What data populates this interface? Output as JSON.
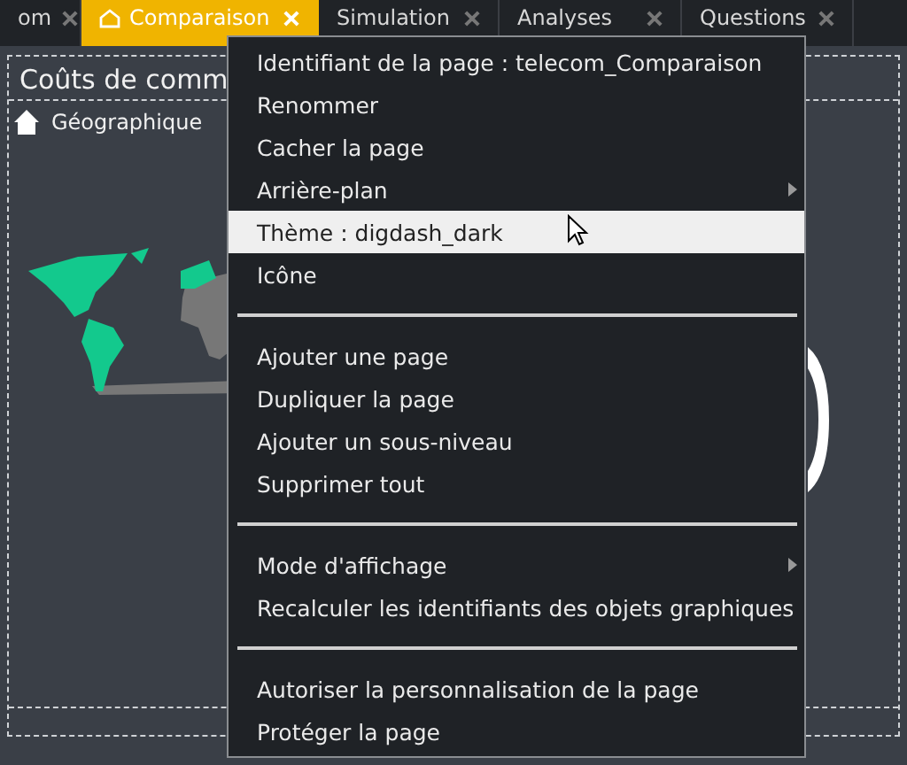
{
  "tabs": [
    {
      "label": "om",
      "selected": false,
      "icon": false
    },
    {
      "label": "Comparaison",
      "selected": true,
      "icon": true
    },
    {
      "label": "Simulation",
      "selected": false,
      "icon": false
    },
    {
      "label": "Analyses",
      "selected": false,
      "icon": false
    },
    {
      "label": "Questions",
      "selected": false,
      "icon": false
    }
  ],
  "panel": {
    "title": "Coûts de comm",
    "breadcrumb": "Géographique"
  },
  "context_menu": {
    "items": [
      {
        "kind": "item",
        "label": "Identifiant de la page : telecom_Comparaison",
        "selected": false,
        "submenu": false
      },
      {
        "kind": "item",
        "label": "Renommer",
        "selected": false,
        "submenu": false
      },
      {
        "kind": "item",
        "label": "Cacher la page",
        "selected": false,
        "submenu": false
      },
      {
        "kind": "item",
        "label": "Arrière-plan",
        "selected": false,
        "submenu": true
      },
      {
        "kind": "item",
        "label": "Thème : digdash_dark",
        "selected": true,
        "submenu": false
      },
      {
        "kind": "item",
        "label": "Icône",
        "selected": false,
        "submenu": false
      },
      {
        "kind": "separator"
      },
      {
        "kind": "item",
        "label": "Ajouter une page",
        "selected": false,
        "submenu": false
      },
      {
        "kind": "item",
        "label": "Dupliquer la page",
        "selected": false,
        "submenu": false
      },
      {
        "kind": "item",
        "label": "Ajouter un sous-niveau",
        "selected": false,
        "submenu": false
      },
      {
        "kind": "item",
        "label": "Supprimer tout",
        "selected": false,
        "submenu": false
      },
      {
        "kind": "separator"
      },
      {
        "kind": "item",
        "label": "Mode d'affichage",
        "selected": false,
        "submenu": true
      },
      {
        "kind": "item",
        "label": "Recalculer les identifiants des objets graphiques",
        "selected": false,
        "submenu": false
      },
      {
        "kind": "separator"
      },
      {
        "kind": "item",
        "label": "Autoriser la personnalisation de la page",
        "selected": false,
        "submenu": false
      },
      {
        "kind": "item",
        "label": "Protéger la page",
        "selected": false,
        "submenu": false
      }
    ]
  }
}
